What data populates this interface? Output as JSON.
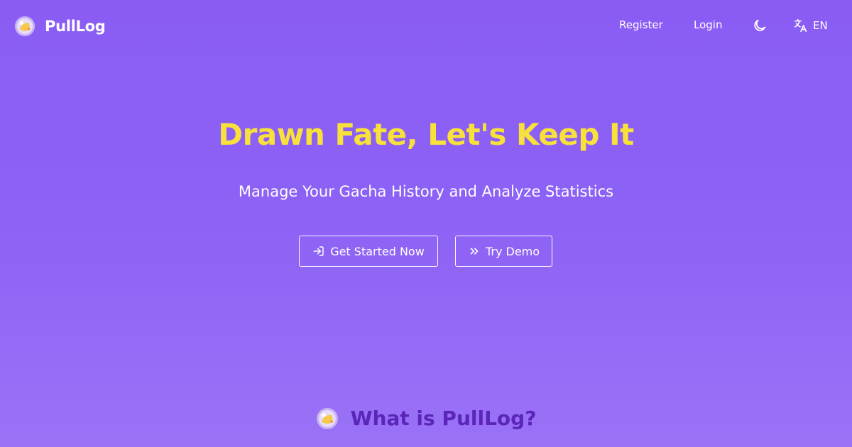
{
  "brand": {
    "name": "PullLog",
    "logo_icon": "crystal-ball-icon"
  },
  "nav": {
    "register": "Register",
    "login": "Login",
    "theme_icon": "moon-icon",
    "language_icon": "translate-icon",
    "language": "EN"
  },
  "hero": {
    "title": "Drawn Fate, Let's Keep It",
    "subtitle": "Manage Your Gacha History and Analyze Statistics",
    "primary_button": {
      "label": "Get Started Now",
      "icon": "login-arrow-icon"
    },
    "secondary_button": {
      "label": "Try Demo",
      "icon": "double-chevron-right-icon"
    }
  },
  "section": {
    "title": "What is PullLog?",
    "icon": "crystal-ball-icon"
  },
  "colors": {
    "background": "#8a5cf4",
    "title_accent": "#f8e13b",
    "section_title": "#5a25b8",
    "text": "#ffffff"
  }
}
